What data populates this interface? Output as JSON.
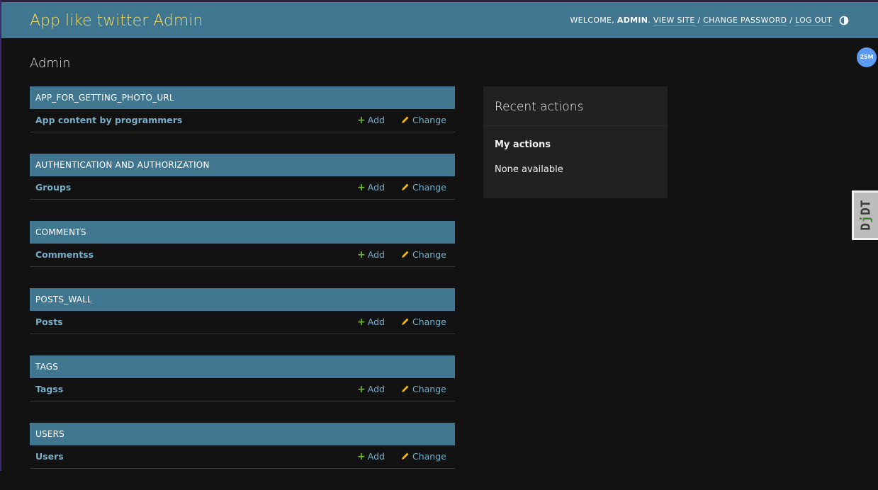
{
  "header": {
    "site_name": "App like twitter Admin",
    "welcome": "WELCOME,",
    "username": "ADMIN",
    "view_site": "VIEW SITE",
    "change_password": "CHANGE PASSWORD",
    "log_out": "LOG OUT",
    "separator": "/",
    "theme_toggle_icon": "half-circle-icon"
  },
  "page": {
    "title": "Admin"
  },
  "apps": [
    {
      "caption": "APP_FOR_GETTING_PHOTO_URL",
      "model": "App content by programmers",
      "add": "Add",
      "change": "Change"
    },
    {
      "caption": "AUTHENTICATION AND AUTHORIZATION",
      "model": "Groups",
      "add": "Add",
      "change": "Change"
    },
    {
      "caption": "COMMENTS",
      "model": "Commentss",
      "add": "Add",
      "change": "Change"
    },
    {
      "caption": "POSTS_WALL",
      "model": "Posts",
      "add": "Add",
      "change": "Change"
    },
    {
      "caption": "TAGS",
      "model": "Tagss",
      "add": "Add",
      "change": "Change"
    },
    {
      "caption": "USERS",
      "model": "Users",
      "add": "Add",
      "change": "Change"
    }
  ],
  "recent_actions": {
    "title": "Recent actions",
    "subtitle": "My actions",
    "empty": "None available"
  },
  "toolbar": {
    "djdt_label_d": "D",
    "djdt_label_j": "j",
    "djdt_label_dt": "DT",
    "badge": "25M"
  },
  "colors": {
    "header_bg": "#417690",
    "site_name": "#f5dd5d",
    "link": "#79aec8",
    "add_icon": "#70bf2b",
    "change_icon": "#efb80b",
    "page_bg": "#121212"
  }
}
